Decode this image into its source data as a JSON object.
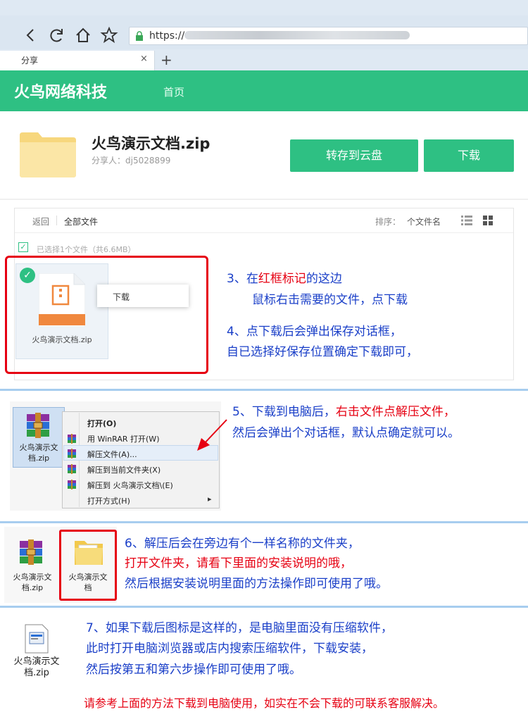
{
  "browser": {
    "url_prefix": "https://",
    "tab_title": "分享",
    "tab_close": "×",
    "new_tab": "+"
  },
  "site": {
    "brand": "火鸟网络科技",
    "nav_home": "首页"
  },
  "file": {
    "name": "火鸟演示文档.zip",
    "sharer": "分享人：dj5028899",
    "save_button": "转存到云盘",
    "download_button": "下载"
  },
  "list": {
    "back": "返回",
    "all_files": "全部文件",
    "sort_label": "排序：",
    "sort_value": "个文件名",
    "selected_info": "已选择1个文件（共6.6MB）",
    "item_type": "ZIP",
    "item_name": "火鸟演示文档.zip",
    "context_download": "下载"
  },
  "notes": {
    "step3_a": "3、在",
    "step3_red": "红框标记",
    "step3_b": "的这边",
    "step3_line2": "鼠标右击需要的文件，点下载",
    "step4_line1": "4、点下载后会弹出保存对话框，",
    "step4_line2": "自已选择好保存位置确定下载即可，",
    "step5_a": "5、下载到电脑后，",
    "step5_red": "右击文件点解压文件，",
    "step5_line2": "然后会弹出个对话框，默认点确定就可以。",
    "step6_line1": "6、解压后会在旁边有个一样名称的文件夹，",
    "step6_line2": "打开文件夹，请看下里面的安装说明的哦，",
    "step6_line3": "然后根据安装说明里面的方法操作即可使用了哦。",
    "step7_line1": "7、如果下载后图标是这样的，是电脑里面没有压缩软件，",
    "step7_line2": "此时打开电脑浏览器或店内搜索压缩软件，下载安装，",
    "step7_line3": "然后按第五和第六步操作即可使用了哦。",
    "footer": "请参考上面的方法下载到电脑使用，如实在不会下载的可联系客服解决。"
  },
  "winrar_menu": {
    "file_name_1": "火鸟演示文",
    "file_name_2": "档.zip",
    "items": [
      "打开(O)",
      "用 WinRAR 打开(W)",
      "解压文件(A)...",
      "解压到当前文件夹(X)",
      "解压到 火鸟演示文档\\(E)",
      "打开方式(H)"
    ],
    "submenu_arrow": "▸"
  },
  "step6_files": {
    "zip_name_1": "火鸟演示文",
    "zip_name_2": "档.zip",
    "folder_name_1": "火鸟演示文",
    "folder_name_2": "档"
  },
  "step7_file": {
    "name_1": "火鸟演示文",
    "name_2": "档.zip"
  },
  "colors": {
    "brand_green": "#2ec083",
    "note_blue": "#1a3fc8",
    "highlight_red": "#e60012"
  },
  "icons": [
    "back-icon",
    "refresh-icon",
    "home-icon",
    "star-icon",
    "lock-icon",
    "folder-icon",
    "list-view-icon",
    "grid-view-icon",
    "check-icon",
    "zip-file-icon",
    "winrar-icon",
    "arrow-icon"
  ]
}
